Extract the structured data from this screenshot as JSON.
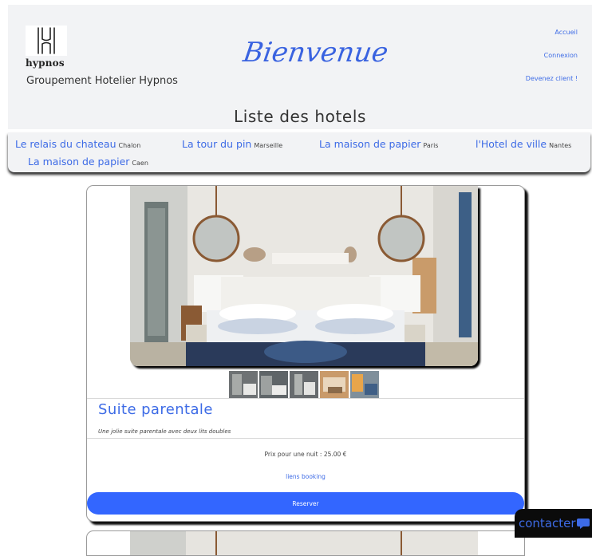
{
  "header": {
    "logo_text": "hypnos",
    "company": "Groupement Hotelier Hypnos",
    "welcome": "Bienvenue",
    "nav": [
      "Accueil",
      "Connexion",
      "Devenez client !"
    ]
  },
  "page_title": "Liste des hotels",
  "hotels": [
    {
      "name": "Le relais du chateau",
      "city": "Chalon"
    },
    {
      "name": "La tour du pin",
      "city": "Marseille"
    },
    {
      "name": "La maison de papier",
      "city": "Paris"
    },
    {
      "name": "l'Hotel de ville",
      "city": "Nantes"
    },
    {
      "name": "La maison de papier",
      "city": "Caen"
    }
  ],
  "room": {
    "title": "Suite parentale",
    "description": "Une jolie suite parentale avec deux lits doubles",
    "price": "Prix pour une nuit : 25.00 €",
    "booking_link": "liens booking",
    "reserve_label": "Reserver"
  },
  "contact_label": "contacter",
  "colors": {
    "accent": "#3d6be6",
    "button": "#3366ff",
    "panel": "#f2f3f5"
  }
}
